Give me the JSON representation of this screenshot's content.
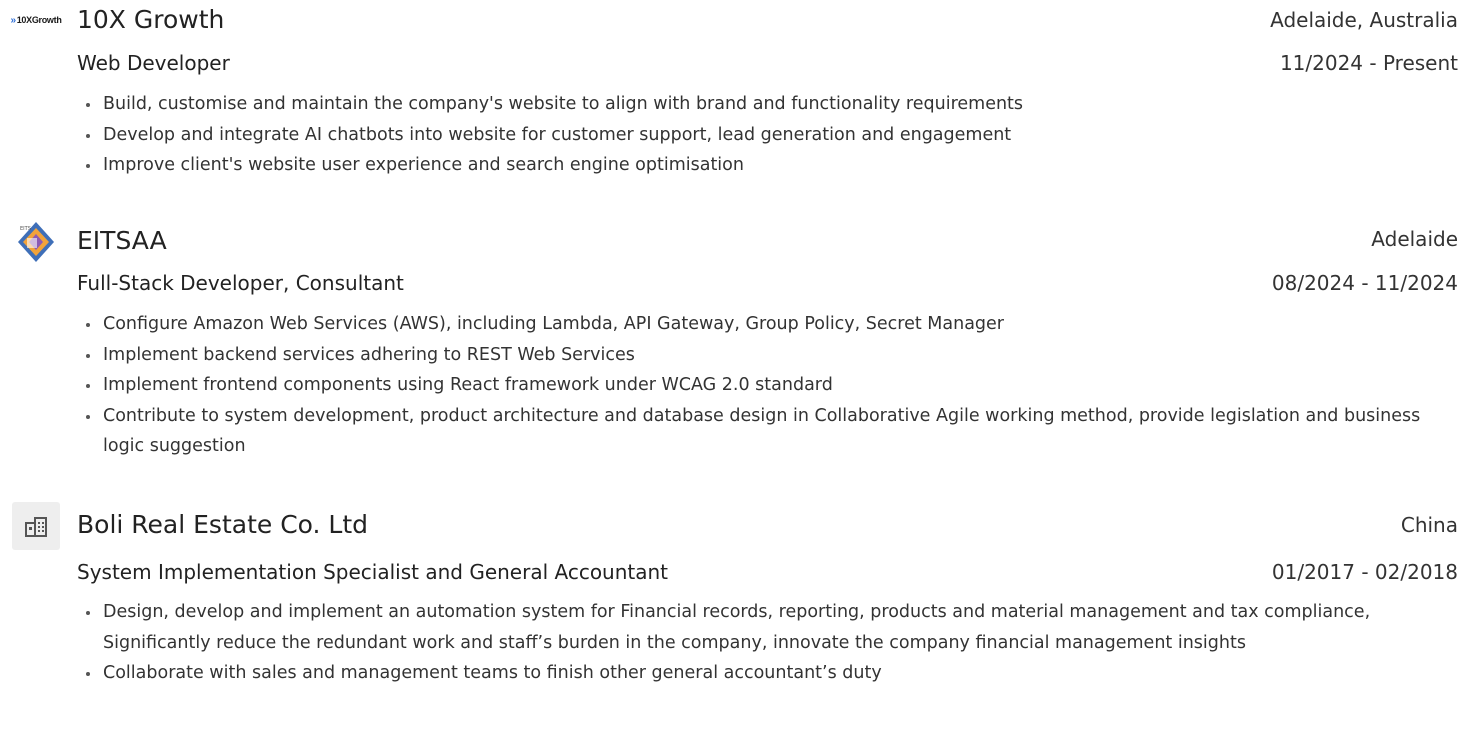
{
  "jobs": [
    {
      "logo_icon": "10x-growth-logo",
      "logo_text": "10XGrowth",
      "company": "10X Growth",
      "location": "Adelaide, Australia",
      "role": "Web Developer",
      "dates": "11/2024 - Present",
      "bullets": [
        "Build, customise and maintain the company's website to align with brand and functionality requirements",
        "Develop and integrate AI chatbots into website for customer support, lead generation and engagement",
        "Improve client's website user experience and search engine optimisation"
      ]
    },
    {
      "logo_icon": "eitsaa-logo",
      "company": "EITSAA",
      "location": "Adelaide",
      "role": "Full-Stack Developer, Consultant",
      "dates": "08/2024 - 11/2024",
      "bullets": [
        "Configure Amazon Web Services (AWS), including Lambda, API Gateway, Group Policy, Secret Manager",
        "Implement backend services adhering to REST Web Services",
        "Implement frontend components using React framework under WCAG 2.0 standard",
        "Contribute to system development, product architecture and database design in Collaborative Agile working method, provide legislation and business logic suggestion"
      ]
    },
    {
      "logo_icon": "building-icon",
      "company": "Boli Real Estate Co. Ltd",
      "location": "China",
      "role": "System Implementation Specialist and General Accountant",
      "dates": "01/2017 - 02/2018",
      "bullets": [
        "Design, develop and implement an automation system for Financial records, reporting, products and material management and tax compliance, Significantly reduce the redundant work and staff’s burden in the company, innovate the company financial management insights",
        "Collaborate with sales and management teams to finish other general accountant’s duty"
      ]
    }
  ],
  "colors": {
    "text": "#333333",
    "heading": "#222222",
    "accent_blue": "#2f6fd6",
    "logo_bg": "#eeeeee"
  }
}
